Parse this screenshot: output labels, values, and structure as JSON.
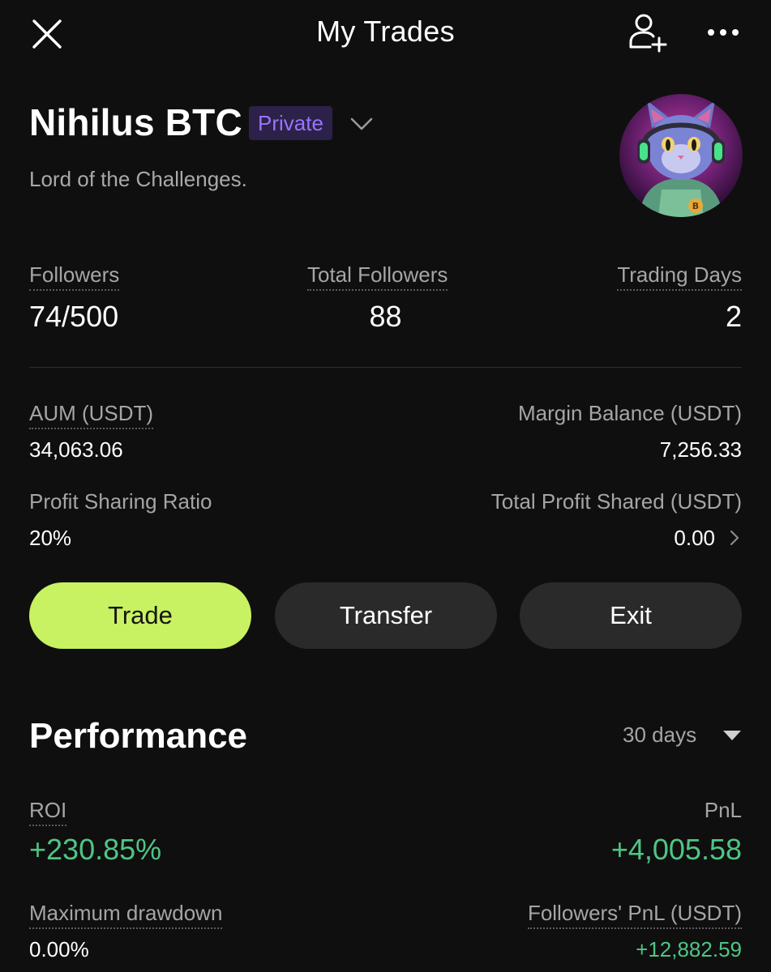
{
  "header": {
    "title": "My Trades",
    "close_icon": "close-icon",
    "add_user_icon": "add-user-icon",
    "more_icon": "more-icon"
  },
  "profile": {
    "name": "Nihilus BTC",
    "badge": "Private",
    "bio": "Lord of the Challenges.",
    "avatar": "cat-with-headphones-avatar"
  },
  "stats": {
    "followers_label": "Followers",
    "followers_value": "74/500",
    "total_followers_label": "Total Followers",
    "total_followers_value": "88",
    "trading_days_label": "Trading Days",
    "trading_days_value": "2"
  },
  "account": {
    "aum_label": "AUM (USDT)",
    "aum_value": "34,063.06",
    "margin_label": "Margin Balance (USDT)",
    "margin_value": "7,256.33",
    "psr_label": "Profit Sharing Ratio",
    "psr_value": "20%",
    "shared_label": "Total Profit Shared (USDT)",
    "shared_value": "0.00"
  },
  "actions": {
    "trade": "Trade",
    "transfer": "Transfer",
    "exit": "Exit"
  },
  "performance": {
    "title": "Performance",
    "period": "30 days",
    "roi_label": "ROI",
    "roi_value": "+230.85%",
    "pnl_label": "PnL",
    "pnl_value": "+4,005.58",
    "drawdown_label": "Maximum drawdown",
    "drawdown_value": "0.00%",
    "followers_pnl_label": "Followers' PnL (USDT)",
    "followers_pnl_value": "+12,882.59"
  },
  "colors": {
    "background": "#0f0f0f",
    "accent_green": "#c8f261",
    "positive": "#4fc584",
    "badge_bg": "#2c2148",
    "badge_text": "#9a74ff"
  }
}
